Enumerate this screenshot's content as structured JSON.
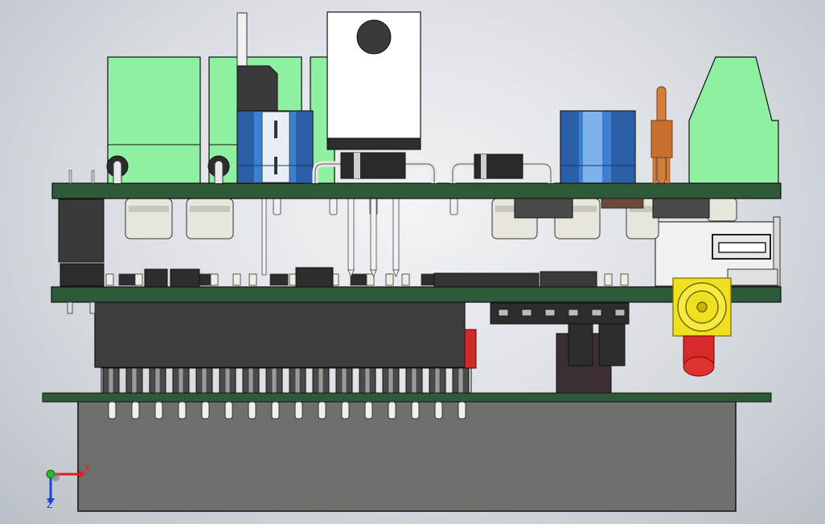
{
  "window": {
    "view": "Front"
  },
  "triad": {
    "x_label": "X",
    "z_label": "Z",
    "x_color": "#e02020",
    "y_color": "#20c020",
    "z_color": "#2040e0"
  },
  "colors": {
    "pcb": "#2f5a3a",
    "pcb_edge": "#1d3a24",
    "relay": "#8ef0a0",
    "terminal_block": "#3ec86a",
    "electrolytic_cap": "#3d7fd0",
    "enclosure": "#6e706c",
    "chip": "#3a3a3a",
    "pin": "#e8e8e8",
    "rca_jack": "#f0e020",
    "led": "#d02020",
    "copper": "#d0803a"
  },
  "parts": [
    "relay",
    "relay",
    "relay",
    "voltage-regulator",
    "electrolytic-capacitor",
    "electrolytic-capacitor",
    "diode",
    "diode",
    "inductor",
    "terminal-block",
    "usb-connector",
    "rca-jack",
    "led",
    "pin-header",
    "enclosure"
  ]
}
